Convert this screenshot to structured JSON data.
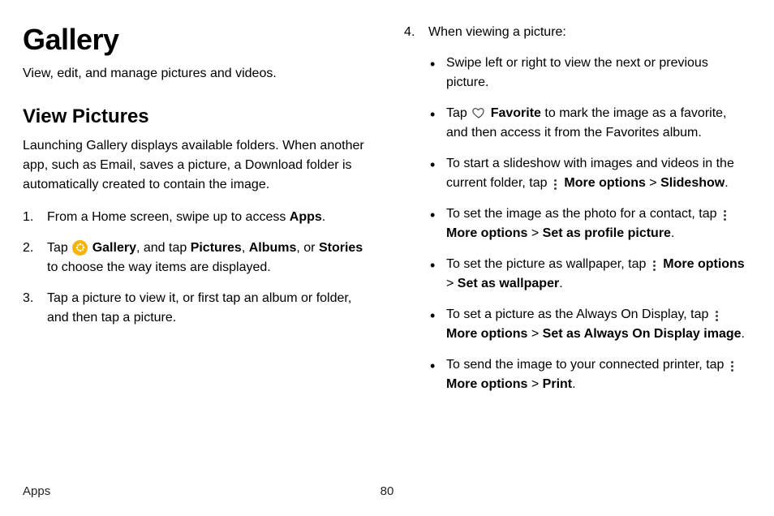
{
  "page": {
    "title": "Gallery",
    "subtitle": "View, edit, and manage pictures and videos."
  },
  "section": {
    "heading": "View Pictures",
    "desc": "Launching Gallery displays available folders. When another app, such as Email, saves a picture, a Download folder is automatically created to contain the image."
  },
  "steps": {
    "s1_a": "From a Home screen, swipe up to access ",
    "s1_b": "Apps",
    "s1_c": ".",
    "s2_a": "Tap ",
    "s2_b": "Gallery",
    "s2_c": ", and tap ",
    "s2_d": "Pictures",
    "s2_e": ", ",
    "s2_f": "Albums",
    "s2_g": ", or ",
    "s2_h": "Stories",
    "s2_i": " to choose the way items are displayed.",
    "s3": "Tap a picture to view it, or first tap an album or folder, and then tap a picture.",
    "s4": "When viewing a picture:"
  },
  "bullets": {
    "b1": "Swipe left or right to view the next or previous picture.",
    "b2_a": "Tap ",
    "b2_b": "Favorite",
    "b2_c": " to mark the image as a favorite, and then access it from the Favorites album.",
    "b3_a": "To start a slideshow with images and videos in the current folder, tap ",
    "b3_b": "More options",
    "b3_c": " > ",
    "b3_d": "Slideshow",
    "b3_e": ".",
    "b4_a": "To set the image as the photo for a contact, tap ",
    "b4_b": "More options",
    "b4_c": " > ",
    "b4_d": "Set as profile picture",
    "b4_e": ".",
    "b5_a": "To set the picture as wallpaper, tap ",
    "b5_b": "More options",
    "b5_c": " > ",
    "b5_d": "Set as wallpaper",
    "b5_e": ".",
    "b6_a": " To set a picture as the Always On Display, tap ",
    "b6_b": "More options",
    "b6_c": " > ",
    "b6_d": "Set as Always On Display image",
    "b6_e": ".",
    "b7_a": "To send the image to your connected printer, tap ",
    "b7_b": "More options",
    "b7_c": " > ",
    "b7_d": "Print",
    "b7_e": "."
  },
  "footer": {
    "section": "Apps",
    "page": "80"
  }
}
